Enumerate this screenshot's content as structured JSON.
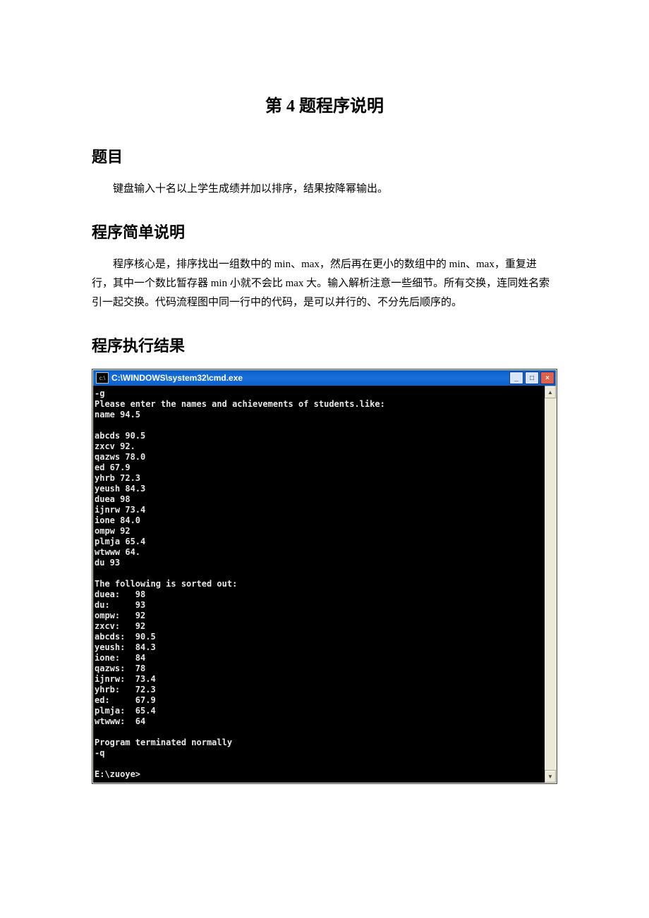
{
  "title": "第 4 题程序说明",
  "h_problem": "题目",
  "problem_body": "键盘输入十名以上学生成绩并加以排序，结果按降幂输出。",
  "h_desc": "程序简单说明",
  "desc_body": "程序核心是，排序找出一组数中的 min、max，然后再在更小的数组中的 min、max，重复进行，其中一个数比暂存器 min 小就不会比 max 大。输入解析注意一些细节。所有交换，连同姓名索引一起交换。代码流程图中同一行中的代码，是可以并行的、不分先后顺序的。",
  "h_result": "程序执行结果",
  "terminal": {
    "icon": "c:\\",
    "window_title": "C:\\WINDOWS\\system32\\cmd.exe",
    "btn_min": "_",
    "btn_max": "□",
    "btn_close": "×",
    "arrow_up": "▲",
    "arrow_down": "▼",
    "output": "-g\nPlease enter the names and achievements of students.like:\nname 94.5\n\nabcds 90.5\nzxcv 92.\nqazws 78.0\ned 67.9\nyhrb 72.3\nyeush 84.3\nduea 98\nijnrw 73.4\nione 84.0\nompw 92\nplmja 65.4\nwtwww 64.\ndu 93\n\nThe following is sorted out:\nduea:   98\ndu:     93\nompw:   92\nzxcv:   92\nabcds:  90.5\nyeush:  84.3\nione:   84\nqazws:  78\nijnrw:  73.4\nyhrb:   72.3\ned:     67.9\nplmja:  65.4\nwtwww:  64\n\nProgram terminated normally\n-q\n\nE:\\zuoye>"
  }
}
